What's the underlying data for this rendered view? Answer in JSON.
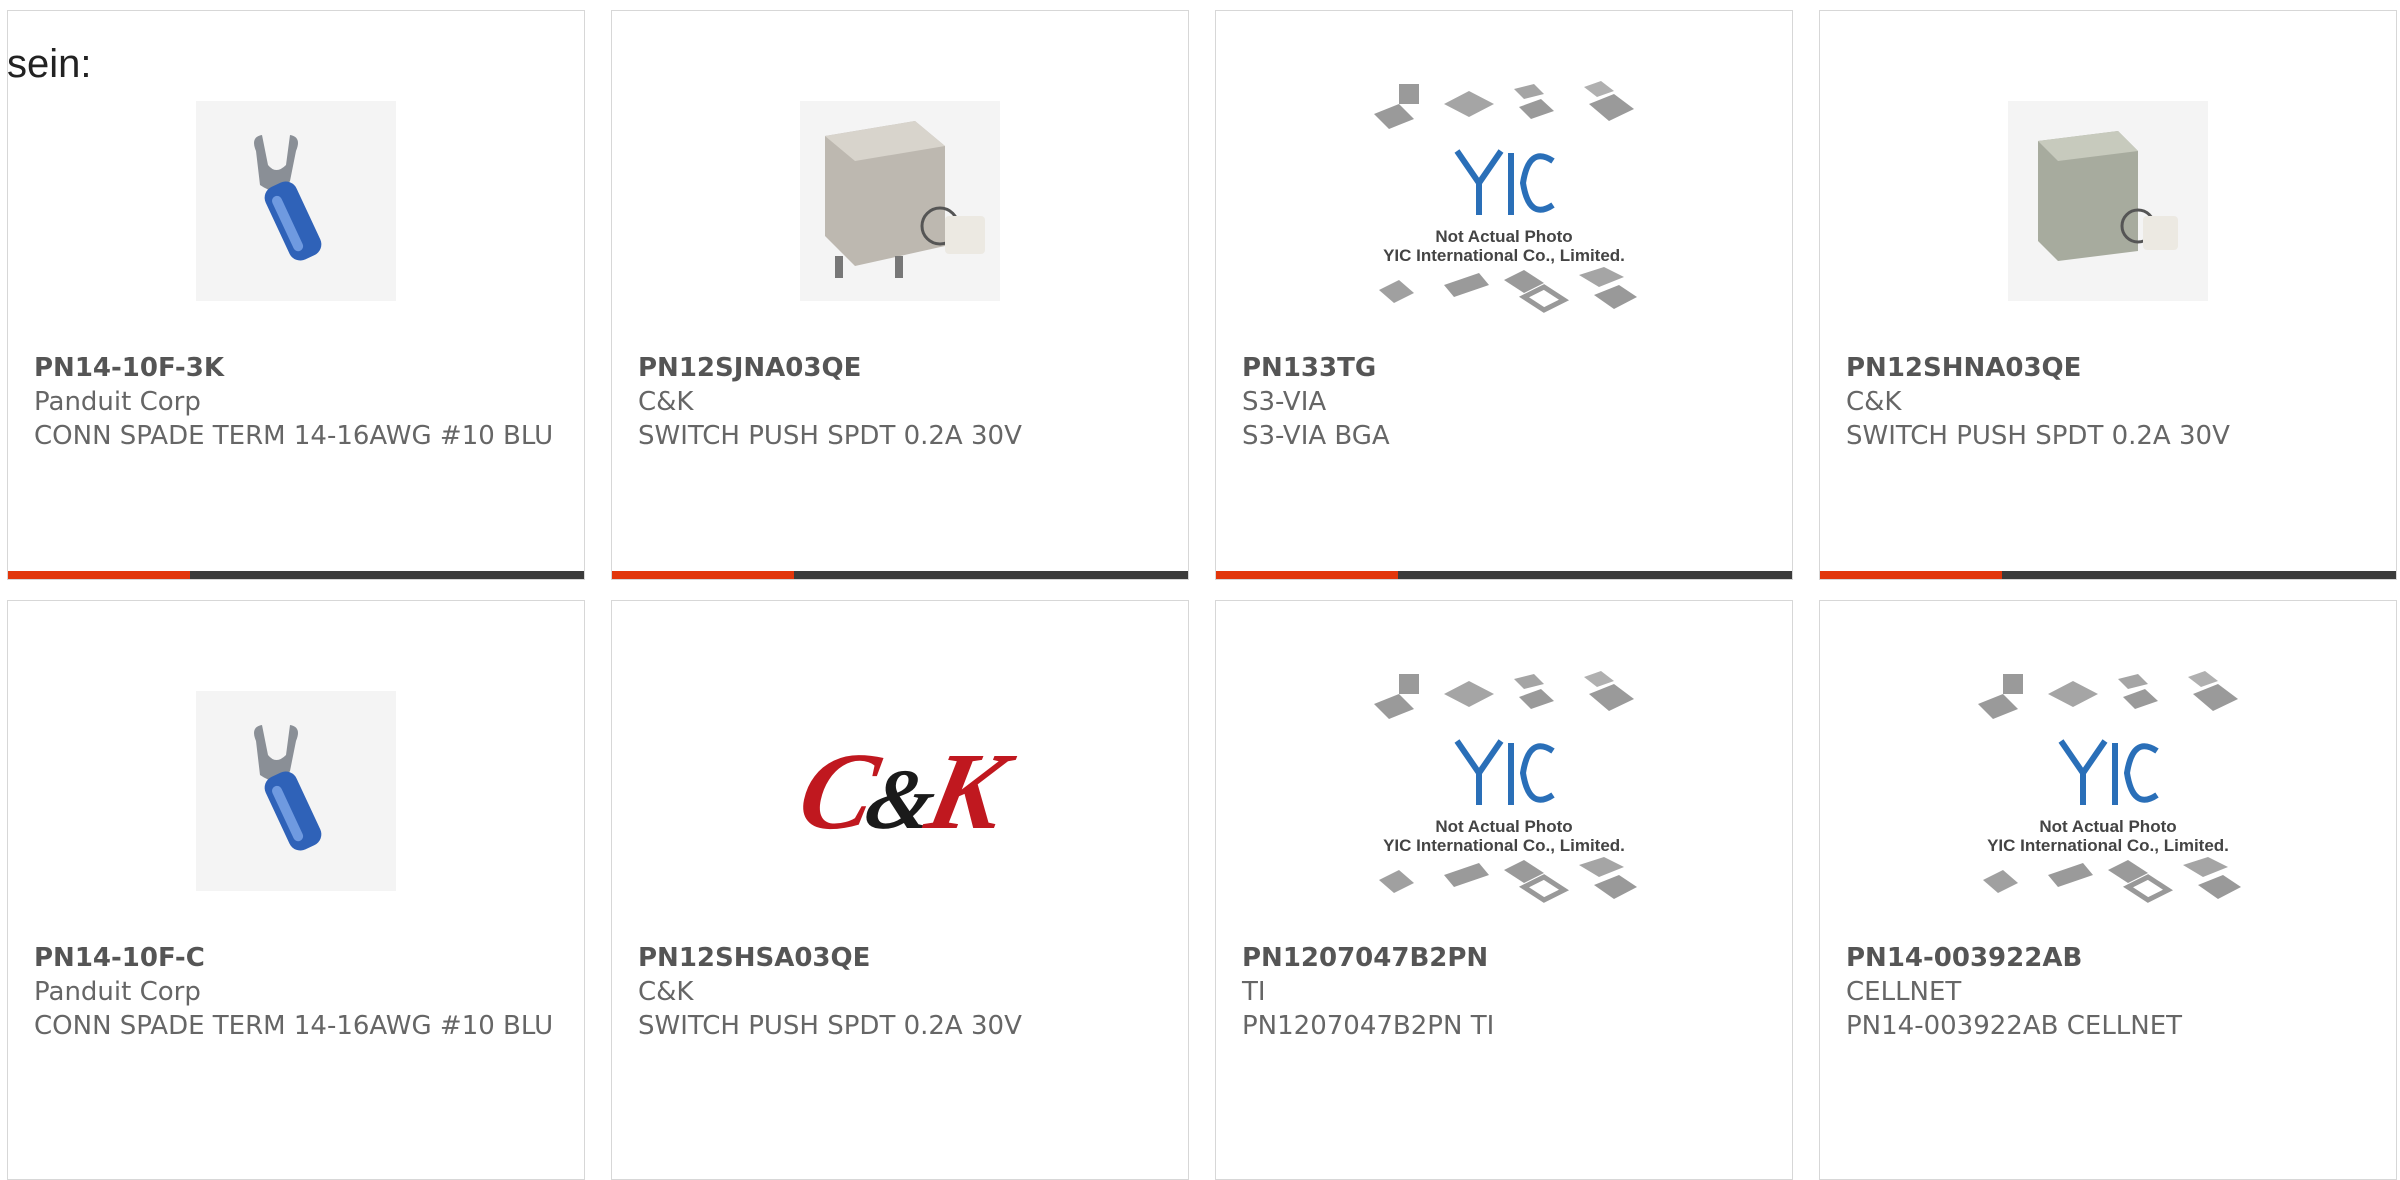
{
  "lead_text": "sein:",
  "colors": {
    "accent": "#e2360b",
    "bar": "#3b3b3b",
    "border": "#d7d7d7"
  },
  "placeholder": {
    "line1": "Not Actual Photo",
    "line2": "YIC International Co., Limited.",
    "logo_text": "YIC"
  },
  "ck_logo": {
    "left": "C",
    "amp": "&",
    "right": "K"
  },
  "products": [
    {
      "part": "PN14-10F-3K",
      "maker": "Panduit Corp",
      "desc": "CONN SPADE TERM 14-16AWG #10 BLU",
      "image": "spade-terminal-icon"
    },
    {
      "part": "PN12SJNA03QE",
      "maker": "C&K",
      "desc": "SWITCH PUSH SPDT 0.2A 30V",
      "image": "push-switch-icon"
    },
    {
      "part": "PN133TG",
      "maker": "S3-VIA",
      "desc": "S3-VIA BGA",
      "image": "yic-placeholder"
    },
    {
      "part": "PN12SHNA03QE",
      "maker": "C&K",
      "desc": "SWITCH PUSH SPDT 0.2A 30V",
      "image": "push-switch-icon"
    },
    {
      "part": "PN14-10F-C",
      "maker": "Panduit Corp",
      "desc": "CONN SPADE TERM 14-16AWG #10 BLU",
      "image": "spade-terminal-icon"
    },
    {
      "part": "PN12SHSA03QE",
      "maker": "C&K",
      "desc": "SWITCH PUSH SPDT 0.2A 30V",
      "image": "ck-logo"
    },
    {
      "part": "PN1207047B2PN",
      "maker": "TI",
      "desc": "PN1207047B2PN TI",
      "image": "yic-placeholder"
    },
    {
      "part": "PN14-003922AB",
      "maker": "CELLNET",
      "desc": "PN14-003922AB CELLNET",
      "image": "yic-placeholder"
    }
  ]
}
